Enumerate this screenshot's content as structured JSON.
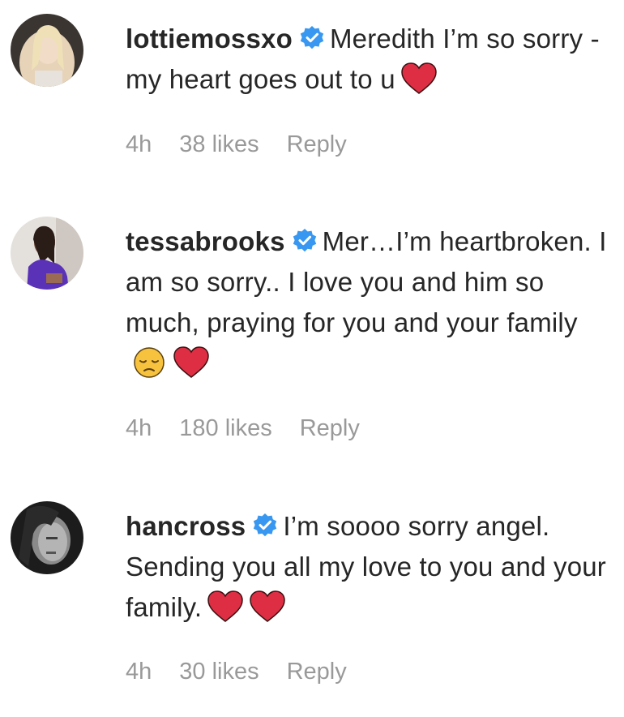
{
  "comments": [
    {
      "username": "lottiemossxo",
      "verified_icon": "verified-badge-icon",
      "text": "Meredith I’m so sorry - my heart goes out to u",
      "emojis": [
        "red-heart-emoji"
      ],
      "time": "4h",
      "likes": "38 likes",
      "reply": "Reply"
    },
    {
      "username": "tessabrooks",
      "verified_icon": "verified-badge-icon",
      "text": "Mer…I’m heartbroken. I am so sorry.. I love you and him so much, praying for you and your family",
      "emojis": [
        "pensive-face-emoji",
        "red-heart-emoji"
      ],
      "time": "4h",
      "likes": "180 likes",
      "reply": "Reply"
    },
    {
      "username": "hancross",
      "verified_icon": "verified-badge-icon",
      "text": "I’m soooo sorry angel. Sending you all my love to you and your family.",
      "emojis": [
        "red-heart-emoji",
        "red-heart-emoji"
      ],
      "time": "4h",
      "likes": "30 likes",
      "reply": "Reply"
    }
  ],
  "colors": {
    "text": "#262626",
    "meta": "#999999",
    "verified": "#3897f0",
    "heart": "#dd2e44"
  }
}
